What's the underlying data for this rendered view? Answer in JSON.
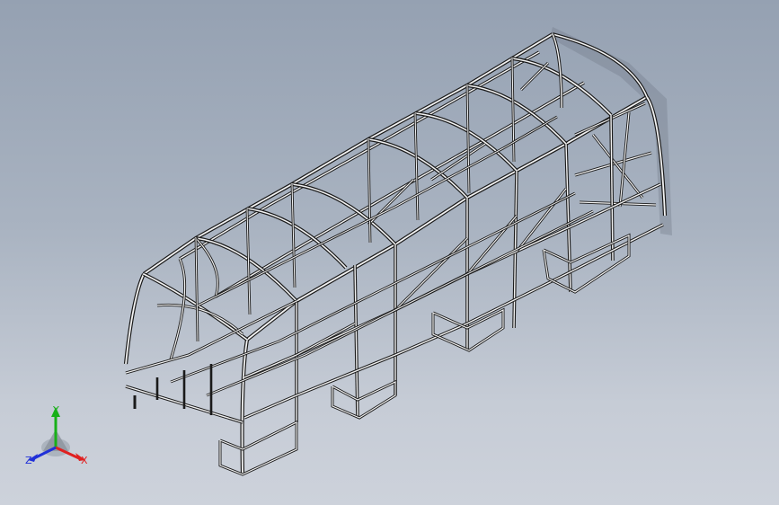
{
  "viewport": {
    "background_top": "#95a1b2",
    "background_bottom": "#cdd2db",
    "model": "bus-frame-wireframe",
    "view": "isometric"
  },
  "triad": {
    "x_label": "X",
    "y_label": "Y",
    "z_label": "Z",
    "x_color": "#e02020",
    "y_color": "#18b018",
    "z_color": "#2030d8"
  }
}
